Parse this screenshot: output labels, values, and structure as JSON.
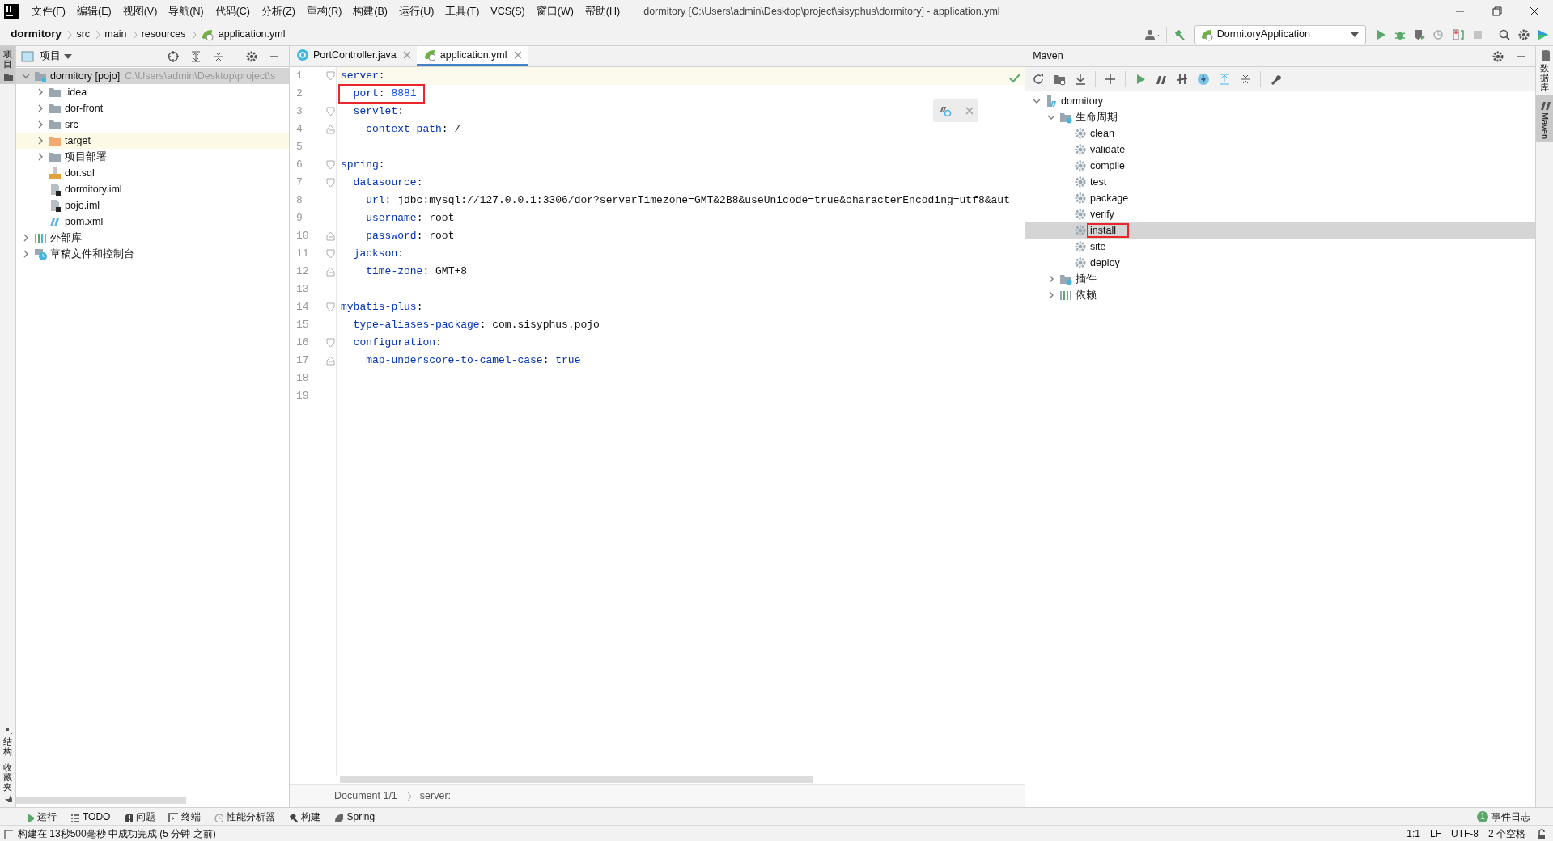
{
  "window": {
    "title": "dormitory [C:\\Users\\admin\\Desktop\\project\\sisyphus\\dormitory] - application.yml"
  },
  "menu": [
    "文件(F)",
    "编辑(E)",
    "视图(V)",
    "导航(N)",
    "代码(C)",
    "分析(Z)",
    "重构(R)",
    "构建(B)",
    "运行(U)",
    "工具(T)",
    "VCS(S)",
    "窗口(W)",
    "帮助(H)"
  ],
  "breadcrumbs": [
    "dormitory",
    "src",
    "main",
    "resources",
    "application.yml"
  ],
  "run_config": {
    "label": "DormitoryApplication"
  },
  "left_strip": [
    {
      "label": "项目",
      "selected": true,
      "kind": "project"
    },
    {
      "label": "结构",
      "selected": false,
      "kind": "structure"
    },
    {
      "label": "收藏夹",
      "selected": false,
      "kind": "favorites"
    }
  ],
  "project_panel": {
    "title": "项目",
    "tree": [
      {
        "label": "dormitory [pojo]",
        "path": "C:\\Users\\admin\\Desktop\\project\\s",
        "kind": "module",
        "expanded": true,
        "selected": true,
        "highlighted": false,
        "children": [
          {
            "label": ".idea",
            "kind": "folder",
            "expanded": false,
            "selected": false,
            "highlighted": false
          },
          {
            "label": "dor-front",
            "kind": "folder",
            "expanded": false,
            "selected": false,
            "highlighted": false
          },
          {
            "label": "src",
            "kind": "folder",
            "expanded": false,
            "selected": false,
            "highlighted": false
          },
          {
            "label": "target",
            "kind": "excluded",
            "expanded": false,
            "selected": false,
            "highlighted": true
          },
          {
            "label": "项目部署",
            "kind": "folder",
            "expanded": false,
            "selected": false,
            "highlighted": false
          },
          {
            "label": "dor.sql",
            "kind": "sql",
            "selected": false,
            "highlighted": false
          },
          {
            "label": "dormitory.iml",
            "kind": "iml",
            "selected": false,
            "highlighted": false
          },
          {
            "label": "pojo.iml",
            "kind": "iml",
            "selected": false,
            "highlighted": false
          },
          {
            "label": "pom.xml",
            "kind": "pom",
            "selected": false,
            "highlighted": false
          }
        ]
      },
      {
        "label": "外部库",
        "kind": "library",
        "expanded": false,
        "selected": false,
        "highlighted": false
      },
      {
        "label": "草稿文件和控制台",
        "kind": "scratch",
        "expanded": false,
        "selected": false,
        "highlighted": false
      }
    ]
  },
  "editor": {
    "tabs": [
      {
        "label": "PortController.java",
        "kind": "java",
        "selected": false
      },
      {
        "label": "application.yml",
        "kind": "yaml",
        "selected": true
      }
    ],
    "lines": [
      {
        "number": "1",
        "tokens": [
          {
            "kind": "key",
            "text": "server"
          },
          {
            "kind": "punct",
            "text": ":"
          }
        ],
        "fold_start": true,
        "current": true
      },
      {
        "number": "2",
        "tokens": [
          {
            "kind": "key",
            "text": "  port"
          },
          {
            "kind": "punct",
            "text": ": "
          },
          {
            "kind": "number",
            "text": "8881"
          }
        ],
        "highlighted": true
      },
      {
        "number": "3",
        "tokens": [
          {
            "kind": "key",
            "text": "  servlet"
          },
          {
            "kind": "punct",
            "text": ":"
          }
        ],
        "fold_start": true
      },
      {
        "number": "4",
        "tokens": [
          {
            "kind": "key",
            "text": "    context-path"
          },
          {
            "kind": "punct",
            "text": ": "
          },
          {
            "kind": "plain",
            "text": "/"
          }
        ],
        "fold_end": true
      },
      {
        "number": "5"
      },
      {
        "number": "6",
        "tokens": [
          {
            "kind": "key",
            "text": "spring"
          },
          {
            "kind": "punct",
            "text": ":"
          }
        ],
        "fold_start": true
      },
      {
        "number": "7",
        "tokens": [
          {
            "kind": "key",
            "text": "  datasource"
          },
          {
            "kind": "punct",
            "text": ":"
          }
        ],
        "fold_start": true
      },
      {
        "number": "8",
        "tokens": [
          {
            "kind": "key",
            "text": "    url"
          },
          {
            "kind": "punct",
            "text": ": "
          },
          {
            "kind": "plain",
            "text": "jdbc:mysql://127.0.0.1:3306/dor?serverTimezone=GMT&2B8&useUnicode=true&characterEncoding=utf8&aut"
          }
        ]
      },
      {
        "number": "9",
        "tokens": [
          {
            "kind": "key",
            "text": "    username"
          },
          {
            "kind": "punct",
            "text": ": "
          },
          {
            "kind": "plain",
            "text": "root"
          }
        ]
      },
      {
        "number": "10",
        "tokens": [
          {
            "kind": "key",
            "text": "    password"
          },
          {
            "kind": "punct",
            "text": ": "
          },
          {
            "kind": "plain",
            "text": "root"
          }
        ],
        "fold_end": true
      },
      {
        "number": "11",
        "tokens": [
          {
            "kind": "key",
            "text": "  jackson"
          },
          {
            "kind": "punct",
            "text": ":"
          }
        ],
        "fold_start": true
      },
      {
        "number": "12",
        "tokens": [
          {
            "kind": "key",
            "text": "    time-zone"
          },
          {
            "kind": "punct",
            "text": ": "
          },
          {
            "kind": "plain",
            "text": "GMT+8"
          }
        ],
        "fold_end": true
      },
      {
        "number": "13"
      },
      {
        "number": "14",
        "tokens": [
          {
            "kind": "key",
            "text": "mybatis-plus"
          },
          {
            "kind": "punct",
            "text": ":"
          }
        ],
        "fold_start": true
      },
      {
        "number": "15",
        "tokens": [
          {
            "kind": "key",
            "text": "  type-aliases-package"
          },
          {
            "kind": "punct",
            "text": ": "
          },
          {
            "kind": "plain",
            "text": "com.sisyphus.pojo"
          }
        ]
      },
      {
        "number": "16",
        "tokens": [
          {
            "kind": "key",
            "text": "  configuration"
          },
          {
            "kind": "punct",
            "text": ":"
          }
        ],
        "fold_start": true
      },
      {
        "number": "17",
        "tokens": [
          {
            "kind": "key",
            "text": "    map-underscore-to-camel-case"
          },
          {
            "kind": "punct",
            "text": ": "
          },
          {
            "kind": "keyword",
            "text": "true"
          }
        ],
        "fold_end": true
      },
      {
        "number": "18"
      },
      {
        "number": "19"
      }
    ],
    "breadcrumb": [
      "Document 1/1",
      "server:"
    ]
  },
  "maven": {
    "title": "Maven",
    "tree": [
      {
        "label": "dormitory",
        "kind": "project",
        "expanded": true,
        "selected": false,
        "highlighted": false,
        "children": [
          {
            "label": "生命周期",
            "kind": "lifecycle",
            "expanded": true,
            "selected": false,
            "highlighted": false,
            "children": [
              {
                "label": "clean",
                "kind": "goal",
                "selected": false,
                "highlighted": false
              },
              {
                "label": "validate",
                "kind": "goal",
                "selected": false,
                "highlighted": false
              },
              {
                "label": "compile",
                "kind": "goal",
                "selected": false,
                "highlighted": false
              },
              {
                "label": "test",
                "kind": "goal",
                "selected": false,
                "highlighted": false
              },
              {
                "label": "package",
                "kind": "goal",
                "selected": false,
                "highlighted": false
              },
              {
                "label": "verify",
                "kind": "goal",
                "selected": false,
                "highlighted": false
              },
              {
                "label": "install",
                "kind": "goal",
                "selected": true,
                "highlighted": true
              },
              {
                "label": "site",
                "kind": "goal",
                "selected": false,
                "highlighted": false
              },
              {
                "label": "deploy",
                "kind": "goal",
                "selected": false,
                "highlighted": false
              }
            ]
          },
          {
            "label": "插件",
            "kind": "plugins",
            "expanded": false,
            "selected": false,
            "highlighted": false
          },
          {
            "label": "依赖",
            "kind": "dependencies",
            "expanded": false,
            "selected": false,
            "highlighted": false
          }
        ]
      }
    ]
  },
  "right_strip": [
    {
      "label": "数据库",
      "selected": false,
      "kind": "database"
    },
    {
      "label": "Maven",
      "selected": true,
      "kind": "maven"
    }
  ],
  "bottom_tools": [
    {
      "label": "运行",
      "kind": "run"
    },
    {
      "label": "TODO",
      "kind": "todo"
    },
    {
      "label": "问题",
      "kind": "problems"
    },
    {
      "label": "终端",
      "kind": "terminal"
    },
    {
      "label": "性能分析器",
      "kind": "profiler"
    },
    {
      "label": "构建",
      "kind": "build"
    },
    {
      "label": "Spring",
      "kind": "spring"
    }
  ],
  "event_log": {
    "label": "事件日志",
    "count": "1"
  },
  "status_bar": {
    "message": "构建在 13秒500毫秒 中成功完成 (5 分钟 之前)",
    "position": "1:1",
    "line_separator": "LF",
    "encoding": "UTF-8",
    "indent": "2 个空格"
  }
}
